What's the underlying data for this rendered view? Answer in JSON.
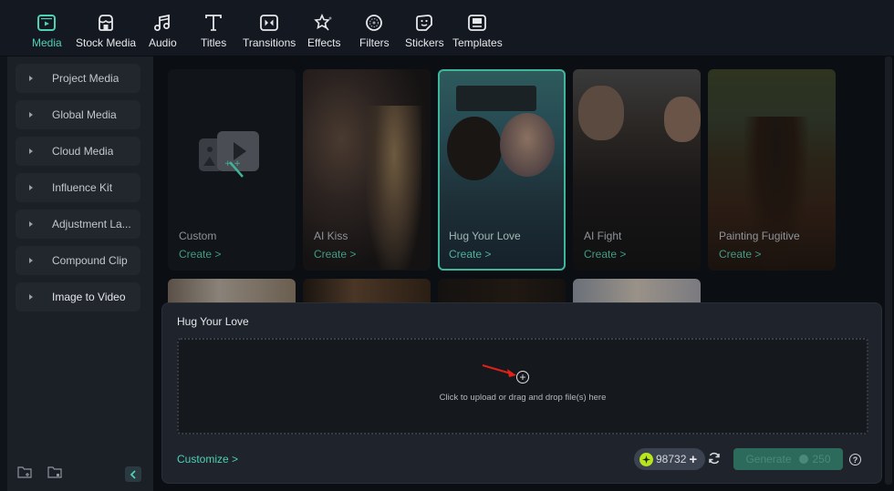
{
  "toolbar": {
    "tabs": [
      {
        "label": "Media",
        "icon": "media-icon",
        "active": true
      },
      {
        "label": "Stock Media",
        "icon": "stock-media-icon",
        "active": false
      },
      {
        "label": "Audio",
        "icon": "music-note-icon",
        "active": false
      },
      {
        "label": "Titles",
        "icon": "text-t-icon",
        "active": false
      },
      {
        "label": "Transitions",
        "icon": "transitions-icon",
        "active": false
      },
      {
        "label": "Effects",
        "icon": "effects-sparkle-icon",
        "active": false
      },
      {
        "label": "Filters",
        "icon": "filters-icon",
        "active": false
      },
      {
        "label": "Stickers",
        "icon": "sticker-icon",
        "active": false
      },
      {
        "label": "Templates",
        "icon": "templates-icon",
        "active": false
      }
    ],
    "accent_color": "#4fd1b3"
  },
  "sidebar": {
    "items": [
      {
        "label": "Project Media"
      },
      {
        "label": "Global Media"
      },
      {
        "label": "Cloud Media"
      },
      {
        "label": "Influence Kit"
      },
      {
        "label": "Adjustment La..."
      },
      {
        "label": "Compound Clip"
      },
      {
        "label": "Image to Video"
      }
    ],
    "footer_icons": [
      "new-folder-icon",
      "import-folder-icon"
    ],
    "collapse_icon": "chevron-left-icon"
  },
  "gallery": {
    "cards": [
      {
        "title": "Custom",
        "action": "Create >",
        "selected": false
      },
      {
        "title": "AI Kiss",
        "action": "Create >",
        "selected": false
      },
      {
        "title": "Hug Your Love",
        "action": "Create >",
        "selected": true
      },
      {
        "title": "AI Fight",
        "action": "Create >",
        "selected": false
      },
      {
        "title": "Painting Fugitive",
        "action": "Create >",
        "selected": false
      }
    ]
  },
  "panel": {
    "title": "Hug Your Love",
    "upload_text": "Click to upload or drag and drop file(s) here",
    "customize_label": "Customize >",
    "credits": "98732",
    "generate_label": "Generate",
    "generate_cost": "250"
  }
}
